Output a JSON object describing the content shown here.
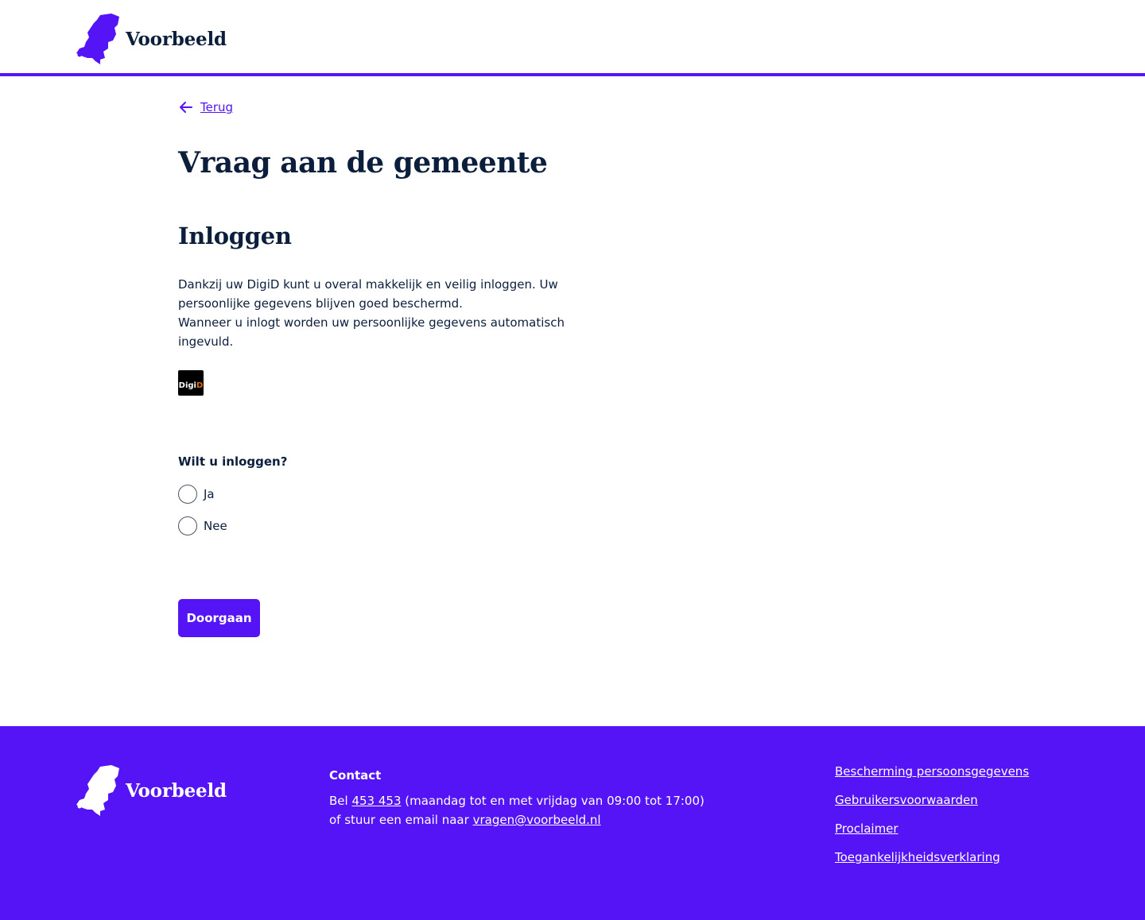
{
  "header": {
    "brand_name": "Voorbeeld"
  },
  "nav": {
    "back_label": "Terug"
  },
  "page": {
    "title": "Vraag aan de gemeente",
    "section_title": "Inloggen",
    "intro_line1": "Dankzij uw DigiD kunt u overal makkelijk en veilig inloggen. Uw persoonlijke gegevens blijven goed beschermd.",
    "intro_line2": "Wanneer u inlogt worden uw persoonlijke gegevens automatisch ingevuld.",
    "digid_logo_text_a": "Digi",
    "digid_logo_text_b": "D"
  },
  "form": {
    "question": "Wilt u inloggen?",
    "options": [
      {
        "label": "Ja",
        "selected": false
      },
      {
        "label": "Nee",
        "selected": false
      }
    ],
    "submit_label": "Doorgaan"
  },
  "footer": {
    "brand_name": "Voorbeeld",
    "contact_title": "Contact",
    "contact_bel": "Bel",
    "contact_phone": "453 453",
    "contact_hours": "(maandag tot en met vrijdag van 09:00 tot 17:00)",
    "contact_email_prefix": "of stuur een email naar",
    "contact_email": "vragen@voorbeeld.nl",
    "links": [
      "Bescherming persoonsgegevens",
      "Gebruikersvoorwaarden",
      "Proclaimer",
      "Toegankelijkheidsverklaring"
    ]
  },
  "colors": {
    "primary": "#5514f5",
    "text": "#0b1f3d",
    "digid_accent": "#e17000"
  },
  "icons": {
    "logo": "netherlands-map-icon",
    "back": "arrow-left-icon"
  }
}
